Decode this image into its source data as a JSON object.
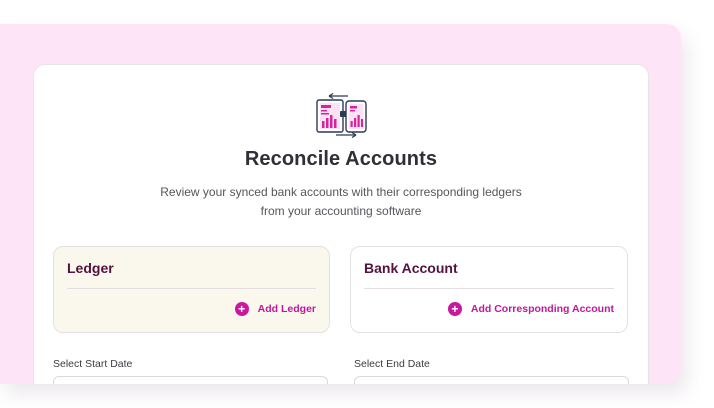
{
  "header": {
    "icon": "reconcile-devices-icon",
    "title": "Reconcile Accounts",
    "subtitle_line1": "Review your synced bank accounts with their corresponding ledgers",
    "subtitle_line2": "from your accounting software"
  },
  "ledger": {
    "title": "Ledger",
    "add_label": "Add Ledger"
  },
  "bank": {
    "title": "Bank Account",
    "add_label": "Add Corresponding Account"
  },
  "dates": {
    "start_label": "Select Start Date",
    "end_label": "Select End Date"
  },
  "colors": {
    "page_background": "#fde4f7",
    "accent": "#c8199e",
    "panel_title": "#55123f",
    "ledger_panel_bg": "#faf7ec"
  }
}
